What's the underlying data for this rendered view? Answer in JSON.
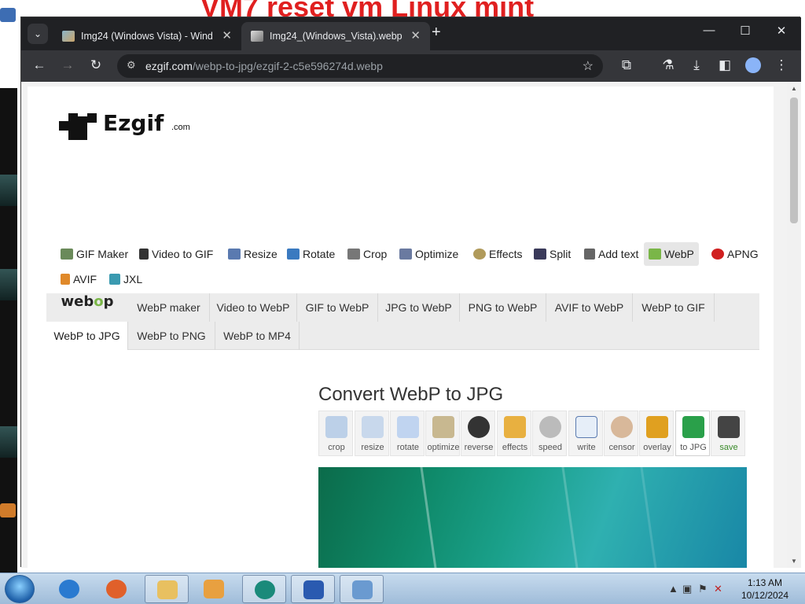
{
  "desktop": {
    "bg_title": "VM7 reset vm Linux mint"
  },
  "browser": {
    "tabs": [
      {
        "title": "Img24 (Windows Vista) - Wind",
        "close": "✕"
      },
      {
        "title": "Img24_(Windows_Vista).webp",
        "close": "✕"
      }
    ],
    "new_tab": "+",
    "tab_search": "⌄",
    "window_controls": {
      "minimize": "—",
      "maximize": "☐",
      "close": "✕"
    },
    "toolbar": {
      "back": "←",
      "forward": "→",
      "reload": "↻",
      "url_host": "ezgif.com",
      "url_path": "/webp-to-jpg/ezgif-2-c5e596274d.webp",
      "star": "☆",
      "icons": [
        "extensions-icon",
        "labs-icon",
        "download-icon",
        "sidepanel-icon",
        "profile-icon",
        "menu-icon"
      ]
    }
  },
  "site": {
    "logo_word": "Ezgif",
    "logo_suffix": ".com",
    "main_nav": [
      {
        "label": "GIF Maker"
      },
      {
        "label": "Video to GIF"
      },
      {
        "label": "Resize"
      },
      {
        "label": "Rotate"
      },
      {
        "label": "Crop"
      },
      {
        "label": "Optimize"
      },
      {
        "label": "Effects"
      },
      {
        "label": "Split"
      },
      {
        "label": "Add text"
      },
      {
        "label": "WebP",
        "active": true
      },
      {
        "label": "APNG"
      },
      {
        "label": "AVIF"
      },
      {
        "label": "JXL"
      }
    ],
    "webp_logo": {
      "pre": "web",
      "o": "o",
      "post": "p"
    },
    "sub_nav": [
      "WebP maker",
      "Video to WebP",
      "GIF to WebP",
      "JPG to WebP",
      "PNG to WebP",
      "AVIF to WebP",
      "WebP to GIF",
      "WebP to JPG",
      "WebP to PNG",
      "WebP to MP4"
    ],
    "heading": "Convert WebP to JPG",
    "tools": [
      "crop",
      "resize",
      "rotate",
      "optimize",
      "reverse",
      "effects",
      "speed",
      "write",
      "censor",
      "overlay",
      "to JPG",
      "save"
    ]
  },
  "taskbar": {
    "time": "1:13 AM",
    "date": "10/12/2024"
  },
  "colors": {
    "chrome_dark": "#202124",
    "chrome_toolbar": "#35363a",
    "ezgif_green": "#7ab648",
    "taskbar": "#b4cde6"
  }
}
